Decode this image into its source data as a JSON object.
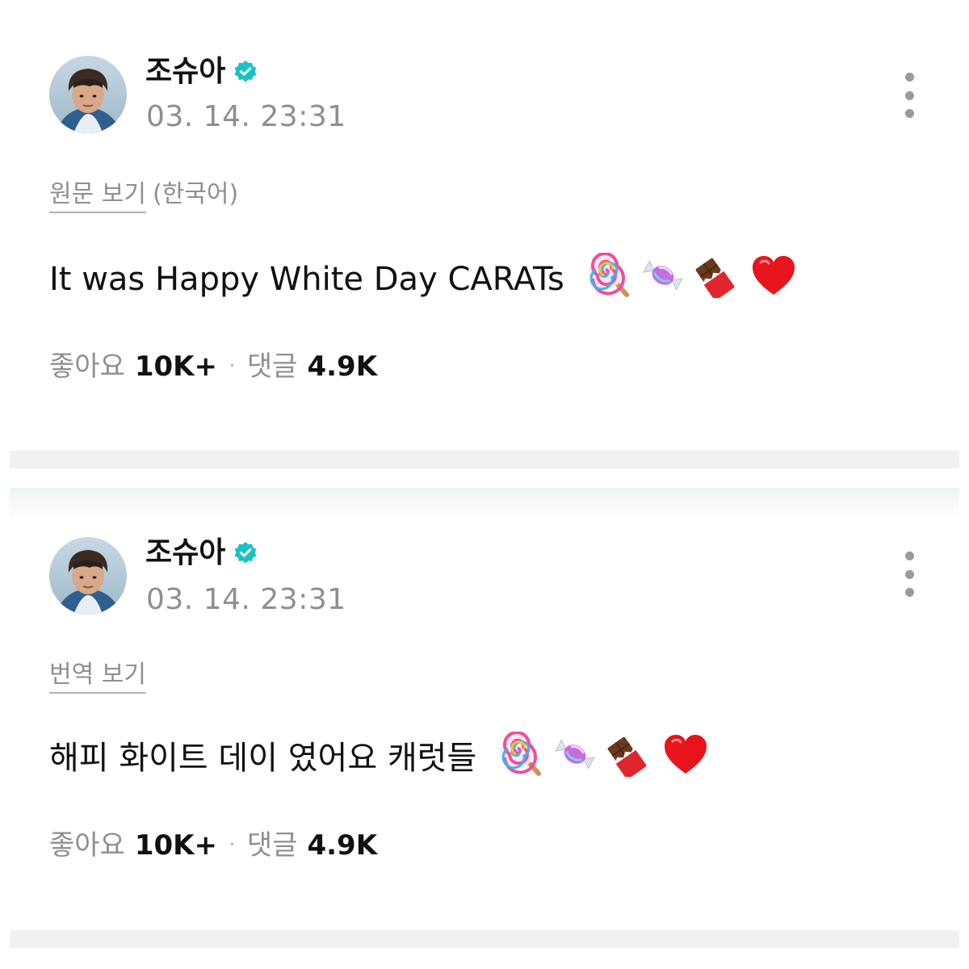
{
  "posts": [
    {
      "author": "조슈아",
      "verified": true,
      "timestamp": "03. 14. 23:31",
      "translate_link": "원문 보기",
      "translate_lang": "(한국어)",
      "content_text": "It was Happy White Day CARATs",
      "emojis": [
        "lollipop-icon",
        "candy-icon",
        "chocolate-bar-icon",
        "red-heart-icon"
      ],
      "likes_label": "좋아요",
      "likes_value": "10K+",
      "separator": "·",
      "comments_label": "댓글",
      "comments_value": "4.9K"
    },
    {
      "author": "조슈아",
      "verified": true,
      "timestamp": "03. 14. 23:31",
      "translate_link": "번역 보기",
      "translate_lang": "",
      "content_text": "해피 화이트 데이 였어요 캐럿들",
      "emojis": [
        "lollipop-icon",
        "candy-icon",
        "chocolate-bar-icon",
        "red-heart-icon"
      ],
      "likes_label": "좋아요",
      "likes_value": "10K+",
      "separator": "·",
      "comments_label": "댓글",
      "comments_value": "4.9K"
    }
  ],
  "colors": {
    "verified_badge": "#18c2c4",
    "muted_text": "#8e8e93",
    "primary_text": "#111111",
    "divider_band": "#f1f1f3"
  }
}
